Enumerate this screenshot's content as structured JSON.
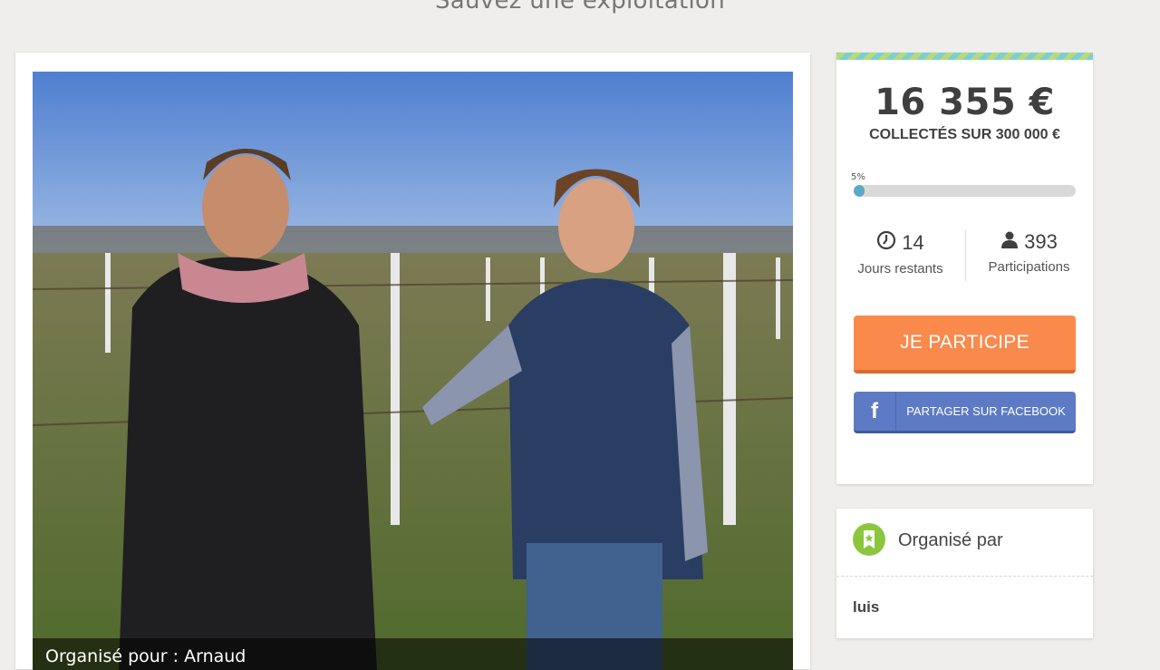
{
  "page": {
    "title": "Sauvez une exploitation"
  },
  "photo": {
    "caption": "Organisé pour : Arnaud"
  },
  "campaign": {
    "amount": "16 355 €",
    "goal_label": "COLLECTÉS SUR 300 000 €",
    "progress_label": "5%",
    "progress_fraction": 0.05,
    "days_value": "14",
    "days_label": "Jours restants",
    "participants_value": "393",
    "participants_label": "Participations",
    "participate_button": "JE PARTICIPE",
    "facebook_icon": "f",
    "facebook_button": "PARTAGER SUR FACEBOOK"
  },
  "organizer": {
    "title": "Organisé par",
    "name": "luis"
  },
  "colors": {
    "accent_orange": "#f98a4c",
    "facebook_blue": "#5d7bc4",
    "progress_blue": "#5aa9c9",
    "organizer_green": "#8cc63f"
  },
  "icons": [
    "clock-icon",
    "user-icon",
    "facebook-icon",
    "badge-icon"
  ]
}
